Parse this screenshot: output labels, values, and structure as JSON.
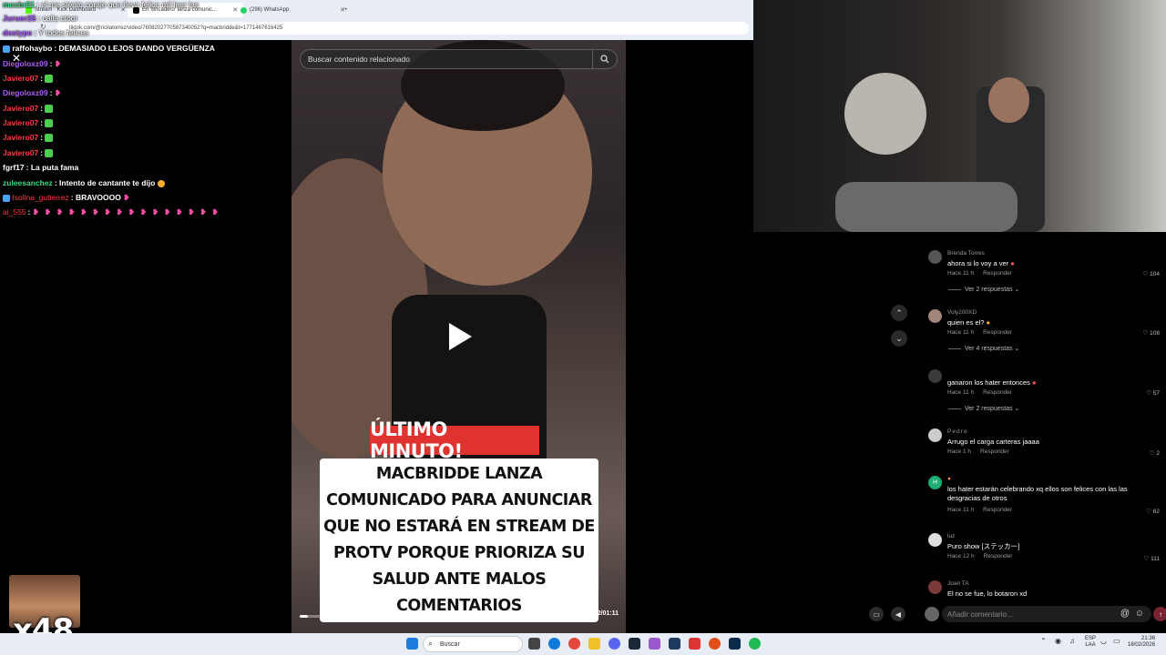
{
  "browser": {
    "tabs": [
      {
        "label": "Stream · Kick Dashboard",
        "active": false
      },
      {
        "label": "En 'Bricadero' lanza comunic...",
        "active": true
      },
      {
        "label": "(296) WhatsApp",
        "active": false
      }
    ],
    "url": "tiktok.com/@ricilatorrez/video/7608202770587340052?q=macbridde&t=1771467616425"
  },
  "chat": {
    "top_partial": [
      {
        "user": "macbr21",
        "text": "el me siento coraje que lleva felice mil leer las"
      },
      {
        "user": "Juruor25",
        "text": "calla ctoor"
      },
      {
        "user": "destype",
        "text": "Y todos felices"
      }
    ],
    "messages": [
      {
        "user": "raffohaybo",
        "user_color": "#ffffff",
        "text": "DEMASIADO LEJOS DANDO VERGÜENZA"
      },
      {
        "user": "Diegoloxz09",
        "user_color": "#b05cff",
        "text": "",
        "emote": "heart"
      },
      {
        "user": "Javiero07",
        "user_color": "#ff3b3b",
        "text": "",
        "emote": "green"
      },
      {
        "user": "Diegoloxz09",
        "user_color": "#b05cff",
        "text": "",
        "emote": "heart"
      },
      {
        "user": "Javiero07",
        "user_color": "#ff3b3b",
        "text": "",
        "emote": "green"
      },
      {
        "user": "Javiero07",
        "user_color": "#ff3b3b",
        "text": "",
        "emote": "green"
      },
      {
        "user": "Javiero07",
        "user_color": "#ff3b3b",
        "text": "",
        "emote": "green"
      },
      {
        "user": "Javiero07",
        "user_color": "#ff3b3b",
        "text": "",
        "emote": "green"
      },
      {
        "user": "fgrf17",
        "user_color": "#ffffff",
        "text": "La puta fama"
      },
      {
        "user": "zuleesanchez",
        "user_color": "#3ddc84",
        "text": "Intento de cantante te dijo"
      },
      {
        "user": "Isolina_gutierrez",
        "user_color": "#ff3b3b",
        "text": "BRAVOOOO"
      },
      {
        "user": "ai_555",
        "user_color": "#ff3b3b",
        "text": "",
        "emote": "heart-row"
      }
    ]
  },
  "video": {
    "search_placeholder": "Buscar contenido relacionado",
    "headline": "ÚLTIMO MINUTO!",
    "caption": "MACBRIDDE LANZA COMUNICADO PARA ANUNCIAR QUE NO ESTARÁ EN STREAM DE PROTV PORQUE PRIORIZA SU SALUD ANTE MALOS COMENTARIOS",
    "time": "00:02/01:11",
    "progress": 0.03
  },
  "comments": [
    {
      "name": "Brenda Torres",
      "text": "ahora si lo voy a ver",
      "age": "Hace 11 h",
      "reply": "Responder",
      "likes": "104",
      "replies": "Ver 2 respuestas"
    },
    {
      "name": "Voly200XD",
      "text": "quien es el?",
      "age": "Hace 11 h",
      "reply": "Responder",
      "likes": "108",
      "replies": "Ver 4 respuestas"
    },
    {
      "name": "",
      "text": "ganaron los hater entonces",
      "age": "Hace 11 h",
      "reply": "Responder",
      "likes": "57",
      "replies": "Ver 2 respuestas"
    },
    {
      "name": "Pedro",
      "text": "Arrugo el carga carteras jaaaa",
      "age": "Hace 1 h",
      "reply": "Responder",
      "likes": "2",
      "replies": ""
    },
    {
      "name": "",
      "text": "los hater estarán celebrando xq ellos son felices con las las desgracias de otros",
      "age": "Hace 11 h",
      "reply": "Responder",
      "likes": "62",
      "replies": ""
    },
    {
      "name": "luz",
      "text": "Puro show [ステッカー]",
      "age": "Hace 12 h",
      "reply": "Responder",
      "likes": "111",
      "replies": ""
    },
    {
      "name": "Joan TA",
      "text": "El no se fue, lo botaron xd",
      "age": "",
      "reply": "",
      "likes": "",
      "replies": ""
    }
  ],
  "comment_bar": {
    "placeholder": "Añadir comentario..."
  },
  "emote_overlay": {
    "count": "x48"
  },
  "taskbar": {
    "search_label": "Buscar",
    "lang": "ESP",
    "lang2": "LAA",
    "time": "21:36",
    "date": "18/02/2026"
  },
  "colors": {
    "accent_red": "#e0322f",
    "tiktok_bg": "#000000"
  }
}
